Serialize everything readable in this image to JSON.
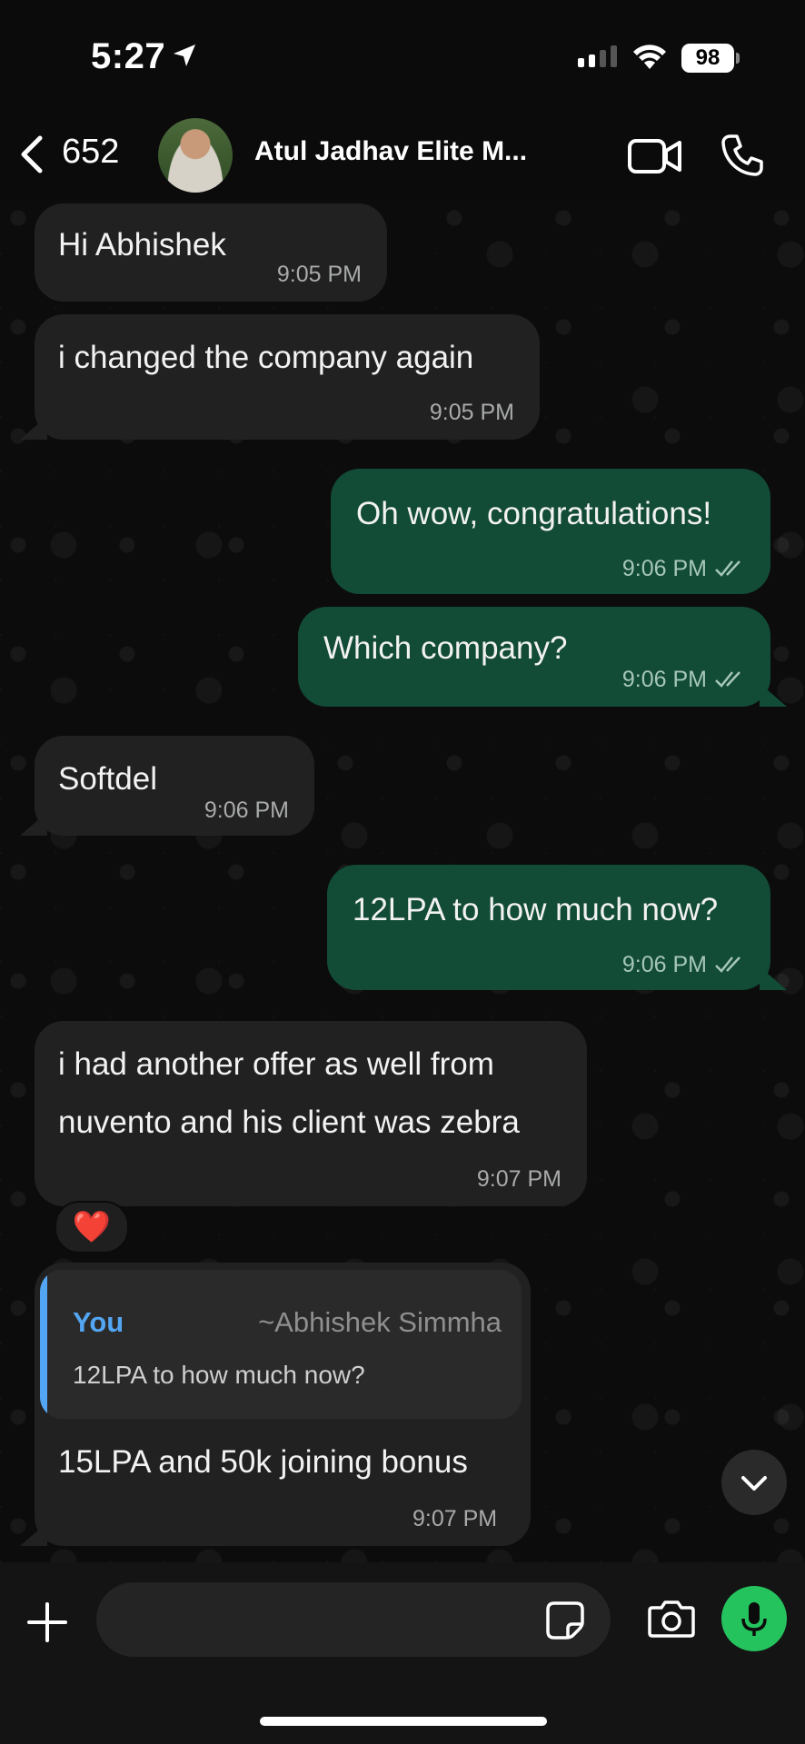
{
  "status_bar": {
    "time": "5:27",
    "battery": "98"
  },
  "header": {
    "back_count": "652",
    "contact_name": "Atul Jadhav Elite M..."
  },
  "messages": [
    {
      "dir": "in",
      "text": "Hi Abhishek",
      "time": "9:05 PM"
    },
    {
      "dir": "in",
      "text": "i changed the company again",
      "time": "9:05 PM"
    },
    {
      "dir": "out",
      "text": "Oh wow, congratulations!",
      "time": "9:06 PM"
    },
    {
      "dir": "out",
      "text": "Which company?",
      "time": "9:06 PM"
    },
    {
      "dir": "in",
      "text": "Softdel",
      "time": "9:06 PM"
    },
    {
      "dir": "out",
      "text": "12LPA to how much now?",
      "time": "9:06 PM"
    },
    {
      "dir": "in",
      "lines": [
        "i had another offer as well from",
        "nuvento and his client was zebra"
      ],
      "time": "9:07 PM",
      "reaction": "❤️"
    },
    {
      "dir": "in",
      "quote": {
        "author": "You",
        "name": "~Abhishek Simmha",
        "text": "12LPA to how much now?"
      },
      "text": "15LPA and 50k joining bonus",
      "time": "9:07 PM"
    }
  ],
  "colors": {
    "incoming": "#212121",
    "outgoing": "#124b36",
    "accent_blue": "#53a6f3",
    "mic_green": "#25c35e"
  }
}
